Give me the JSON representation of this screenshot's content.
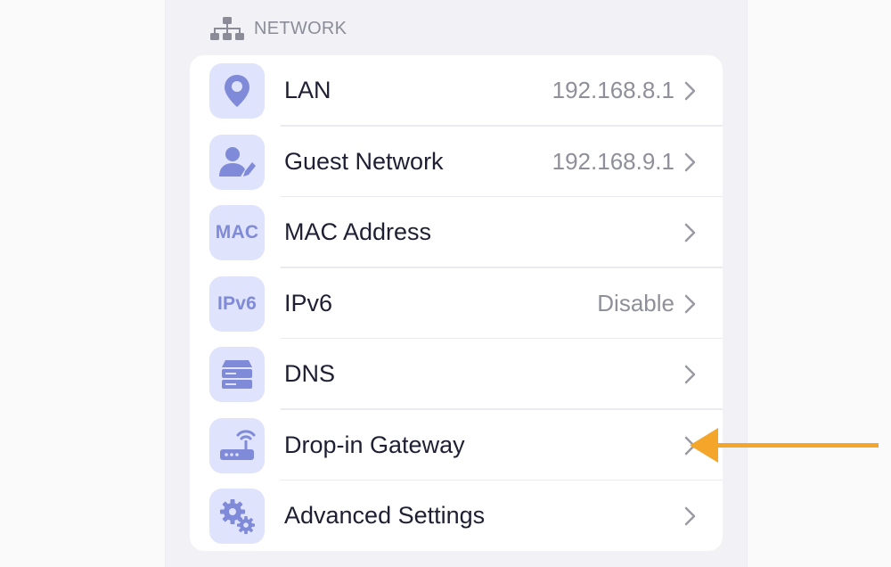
{
  "section": {
    "title": "NETWORK",
    "icon": "network-topology-icon"
  },
  "rows": [
    {
      "label": "LAN",
      "value": "192.168.8.1",
      "icon": "location-pin-icon"
    },
    {
      "label": "Guest Network",
      "value": "192.168.9.1",
      "icon": "user-edit-icon"
    },
    {
      "label": "MAC Address",
      "value": "",
      "icon": "mac-text-icon",
      "icon_text": "MAC"
    },
    {
      "label": "IPv6",
      "value": "Disable",
      "icon": "ipv6-text-icon",
      "icon_text": "IPv6"
    },
    {
      "label": "DNS",
      "value": "",
      "icon": "server-stack-icon"
    },
    {
      "label": "Drop-in Gateway",
      "value": "",
      "icon": "router-wifi-icon"
    },
    {
      "label": "Advanced Settings",
      "value": "",
      "icon": "gears-icon"
    }
  ],
  "colors": {
    "accent": "#7f8ad8",
    "icon_bg": "#dfe3fb",
    "annotation_arrow": "#f4a62a",
    "text": "#1f1f33",
    "muted": "#8f8f99"
  }
}
